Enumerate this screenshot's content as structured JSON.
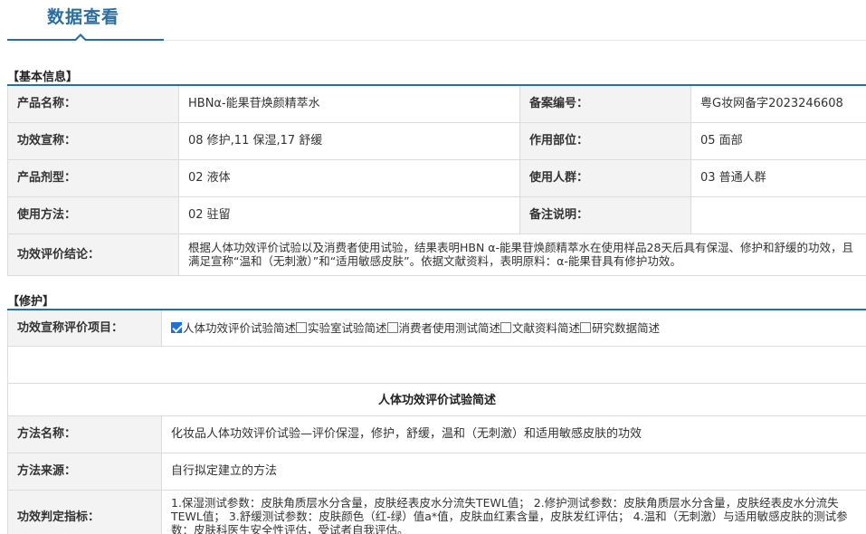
{
  "header": {
    "title": "数据查看"
  },
  "basic": {
    "section_title": "【基本信息】",
    "rows": [
      {
        "l1": "产品名称：",
        "v1": "HBNα-能果苷焕颜精萃水",
        "l2": "备案编号：",
        "v2": "粤G妆网备字2023246608"
      },
      {
        "l1": "功效宣称：",
        "v1": "08 修护,11 保湿,17 舒缓",
        "l2": "作用部位：",
        "v2": "05 面部"
      },
      {
        "l1": "产品剂型：",
        "v1": "02 液体",
        "l2": "使用人群：",
        "v2": "03 普通人群"
      },
      {
        "l1": "使用方法：",
        "v1": "02 驻留",
        "l2": "备注说明：",
        "v2": ""
      }
    ],
    "conclusion_label": "功效评价结论：",
    "conclusion_value": "根据人体功效评价试验以及消费者使用试验，结果表明HBN α-能果苷焕颜精萃水在使用样品28天后具有保湿、修护和舒缓的功效，且满足宣称“温和（无刺激）”和“适用敏感皮肤”。依据文献资料，表明原料：α-能果苷具有修护功效。"
  },
  "repair": {
    "section_title": "【修护】",
    "items_label": "功效宣称评价项目：",
    "checkboxes": [
      {
        "label": "人体功效评价试验简述",
        "checked": true
      },
      {
        "label": "实验室试验简述",
        "checked": false
      },
      {
        "label": "消费者使用测试简述",
        "checked": false
      },
      {
        "label": "文献资料简述",
        "checked": false
      },
      {
        "label": "研究数据简述",
        "checked": false
      }
    ],
    "subsection_title": "人体功效评价试验简述",
    "method_name_label": "方法名称：",
    "method_name_value": "化妆品人体功效评价试验—评价保湿，修护，舒缓，温和（无刺激）和适用敏感皮肤的功效",
    "method_source_label": "方法来源：",
    "method_source_value": "自行拟定建立的方法",
    "indicator_label": "功效判定指标：",
    "indicator_value": "1.保湿测试参数：皮肤角质层水分含量，皮肤经表皮水分流失TEWL值； 2.修护测试参数：皮肤角质层水分含量，皮肤经表皮水分流失TEWL值； 3.舒缓测试参数：皮肤颜色（红-绿）值a*值，皮肤血红素含量，皮肤发红评估； 4.温和（无刺激）与适用敏感皮肤的测试参数：皮肤科医生安全性评估，受试者自我评估。"
  }
}
